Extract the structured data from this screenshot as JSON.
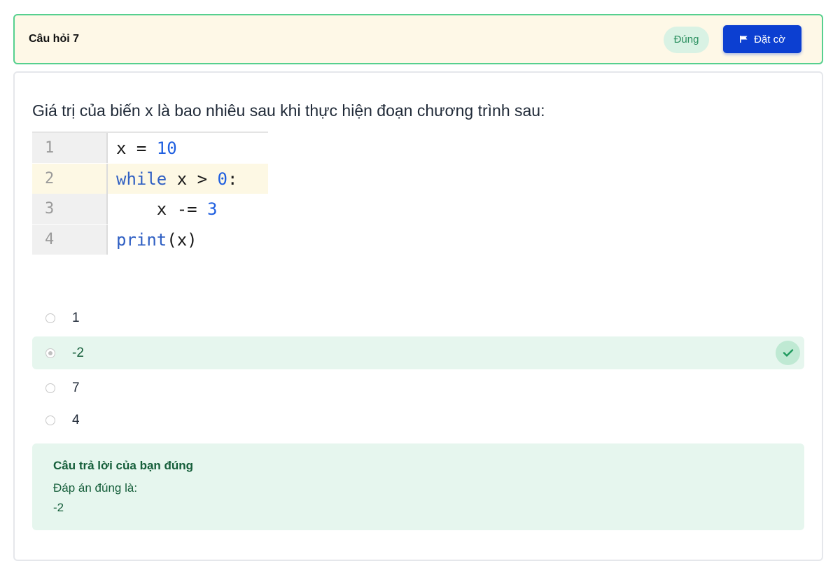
{
  "header": {
    "title": "Câu hỏi 7",
    "status": "Đúng",
    "flag_label": "Đặt cờ"
  },
  "question": {
    "text": "Giá trị của biến x là bao nhiêu sau khi thực hiện đoạn chương trình sau:",
    "code": [
      {
        "line": "1",
        "tokens": [
          [
            "x = ",
            ""
          ],
          [
            "10",
            "num"
          ]
        ]
      },
      {
        "line": "2",
        "tokens": [
          [
            "while",
            "kw"
          ],
          [
            " x > ",
            ""
          ],
          [
            "0",
            "num"
          ],
          [
            ":",
            ""
          ]
        ]
      },
      {
        "line": "3",
        "tokens": [
          [
            "    x -= ",
            ""
          ],
          [
            "3",
            "num"
          ]
        ]
      },
      {
        "line": "4",
        "tokens": [
          [
            "print",
            "kw"
          ],
          [
            "(x)",
            ""
          ]
        ]
      }
    ]
  },
  "options": [
    {
      "label": "1",
      "selected": false,
      "correct": false
    },
    {
      "label": "-2",
      "selected": true,
      "correct": true
    },
    {
      "label": "7",
      "selected": false,
      "correct": false
    },
    {
      "label": "4",
      "selected": false,
      "correct": false
    }
  ],
  "feedback": {
    "title": "Câu trả lời của bạn đúng",
    "answer_label": "Đáp án đúng là:",
    "answer_value": "-2"
  },
  "colors": {
    "header_bg": "#fef8e7",
    "header_border": "#56d08f",
    "flag_button": "#0c3fd1",
    "correct_bg": "#e6f6ee",
    "correct_text": "#155e3a"
  },
  "icons": {
    "flag": "flag-icon",
    "check": "check-icon"
  }
}
